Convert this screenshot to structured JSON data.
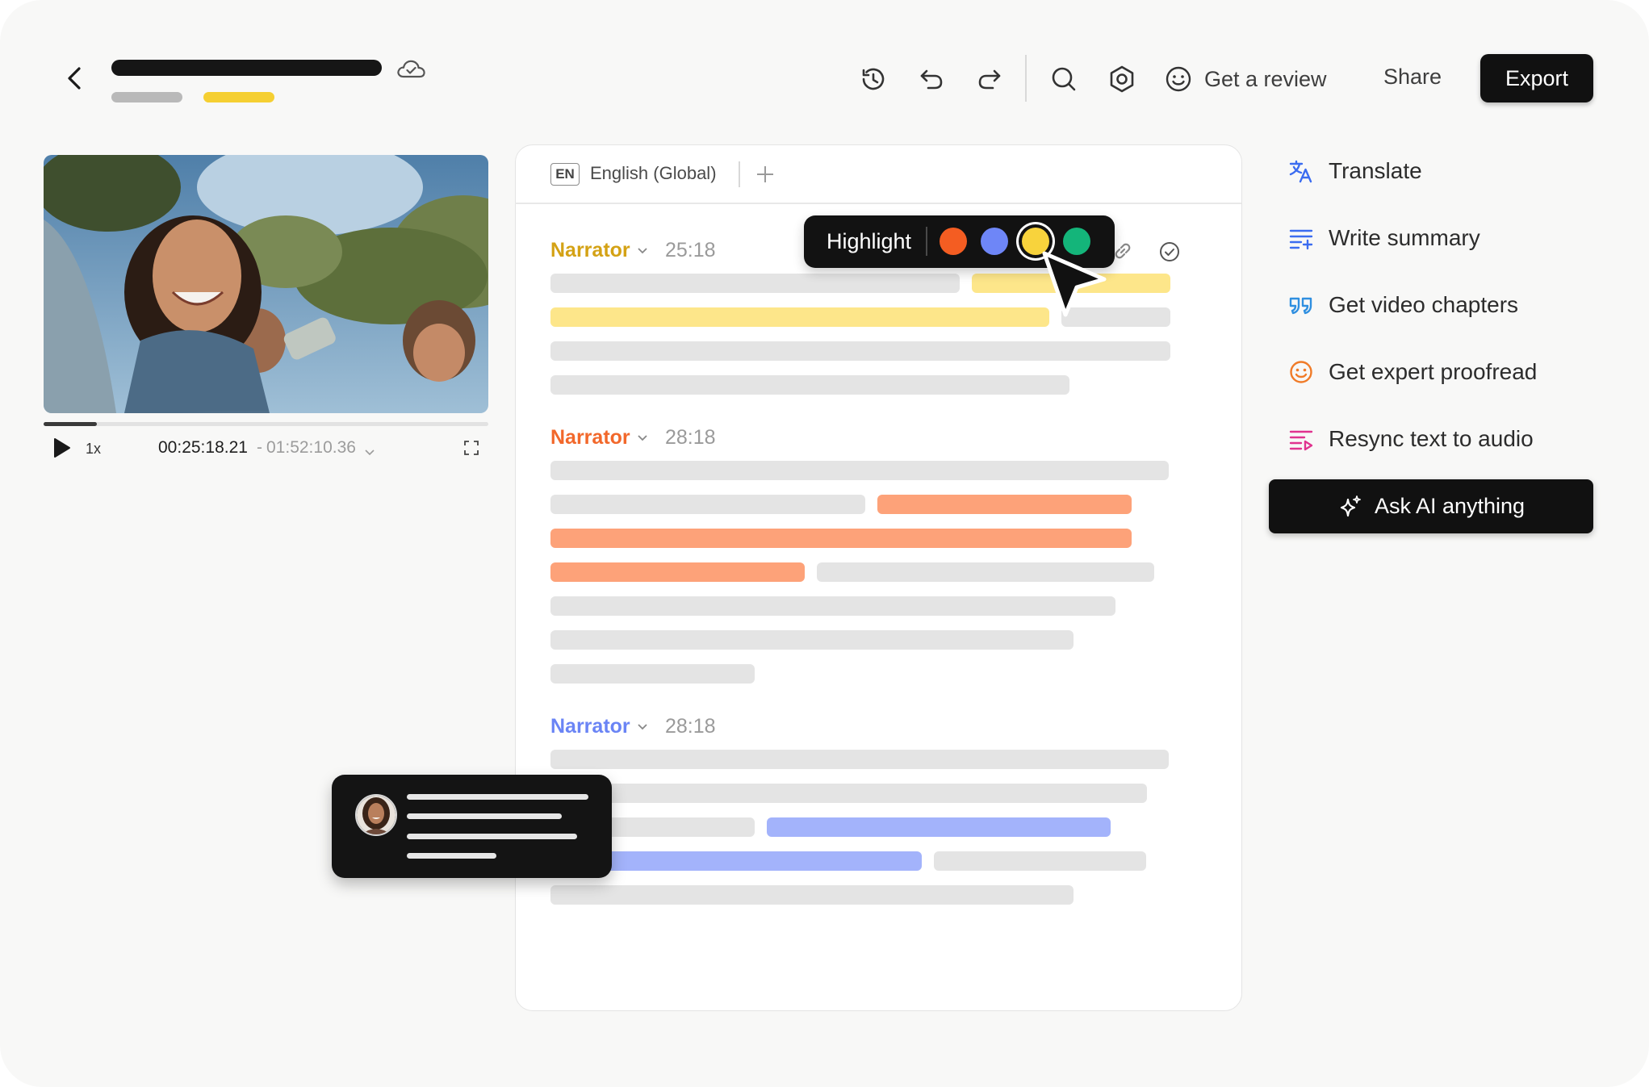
{
  "toolbar": {
    "review_label": "Get a review",
    "share_label": "Share",
    "export_label": "Export"
  },
  "video": {
    "current_time": "00:25:18.21",
    "separator": "-",
    "total_time": "01:52:10.36",
    "speed": "1x",
    "progress": 0.12
  },
  "transcript": {
    "language_code": "EN",
    "language_name": "English (Global)",
    "segments": [
      {
        "speaker": "Narrator",
        "time": "25:18",
        "color": "#d4a215",
        "highlight": "#fde68a"
      },
      {
        "speaker": "Narrator",
        "time": "28:18",
        "color": "#f2682b",
        "highlight": "#fda279"
      },
      {
        "speaker": "Narrator",
        "time": "28:18",
        "color": "#6a84f5",
        "highlight": "#a3b3fb"
      }
    ]
  },
  "highlight_popup": {
    "label": "Highlight",
    "colors": [
      "#f45d22",
      "#6e86f7",
      "#f8d33c",
      "#14b57a"
    ],
    "selected_index": 2
  },
  "actions": [
    {
      "label": "Translate",
      "icon": "translate-icon",
      "color": "#3b6cf0"
    },
    {
      "label": "Write summary",
      "icon": "summary-icon",
      "color": "#3b6cf0"
    },
    {
      "label": "Get video chapters",
      "icon": "quote-icon",
      "color": "#2f8fe0"
    },
    {
      "label": "Get expert proofread",
      "icon": "smiley-icon",
      "color": "#f07b28"
    },
    {
      "label": "Resync text to audio",
      "icon": "resync-icon",
      "color": "#e0338f"
    }
  ],
  "ask_ai": {
    "label": "Ask AI anything",
    "icon": "sparkle-icon"
  }
}
